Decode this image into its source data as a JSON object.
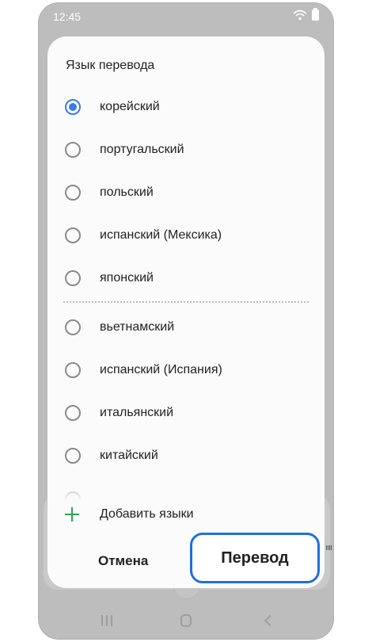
{
  "status_bar": {
    "time": "12:45",
    "icons": [
      "wifi-icon",
      "battery-icon"
    ]
  },
  "dialog": {
    "title": "Язык перевода",
    "languages": [
      {
        "label": "корейский",
        "selected": true
      },
      {
        "label": "португальский",
        "selected": false
      },
      {
        "label": "польский",
        "selected": false
      },
      {
        "label": "испанский (Мексика)",
        "selected": false
      },
      {
        "label": "японский",
        "selected": false
      },
      {
        "label": "вьетнамский",
        "selected": false
      },
      {
        "label": "испанский (Испания)",
        "selected": false
      },
      {
        "label": "итальянский",
        "selected": false
      },
      {
        "label": "китайский",
        "selected": false
      }
    ],
    "add_languages_label": "Добавить языки",
    "cancel_label": "Отмена",
    "translate_label": "Перевод"
  },
  "colors": {
    "accent": "#3a7ce8",
    "highlight_border": "#1f6fe0",
    "add_icon": "#2ea44f"
  },
  "nav_bar": {
    "icons": [
      "recent-apps-icon",
      "home-icon",
      "back-icon"
    ]
  }
}
